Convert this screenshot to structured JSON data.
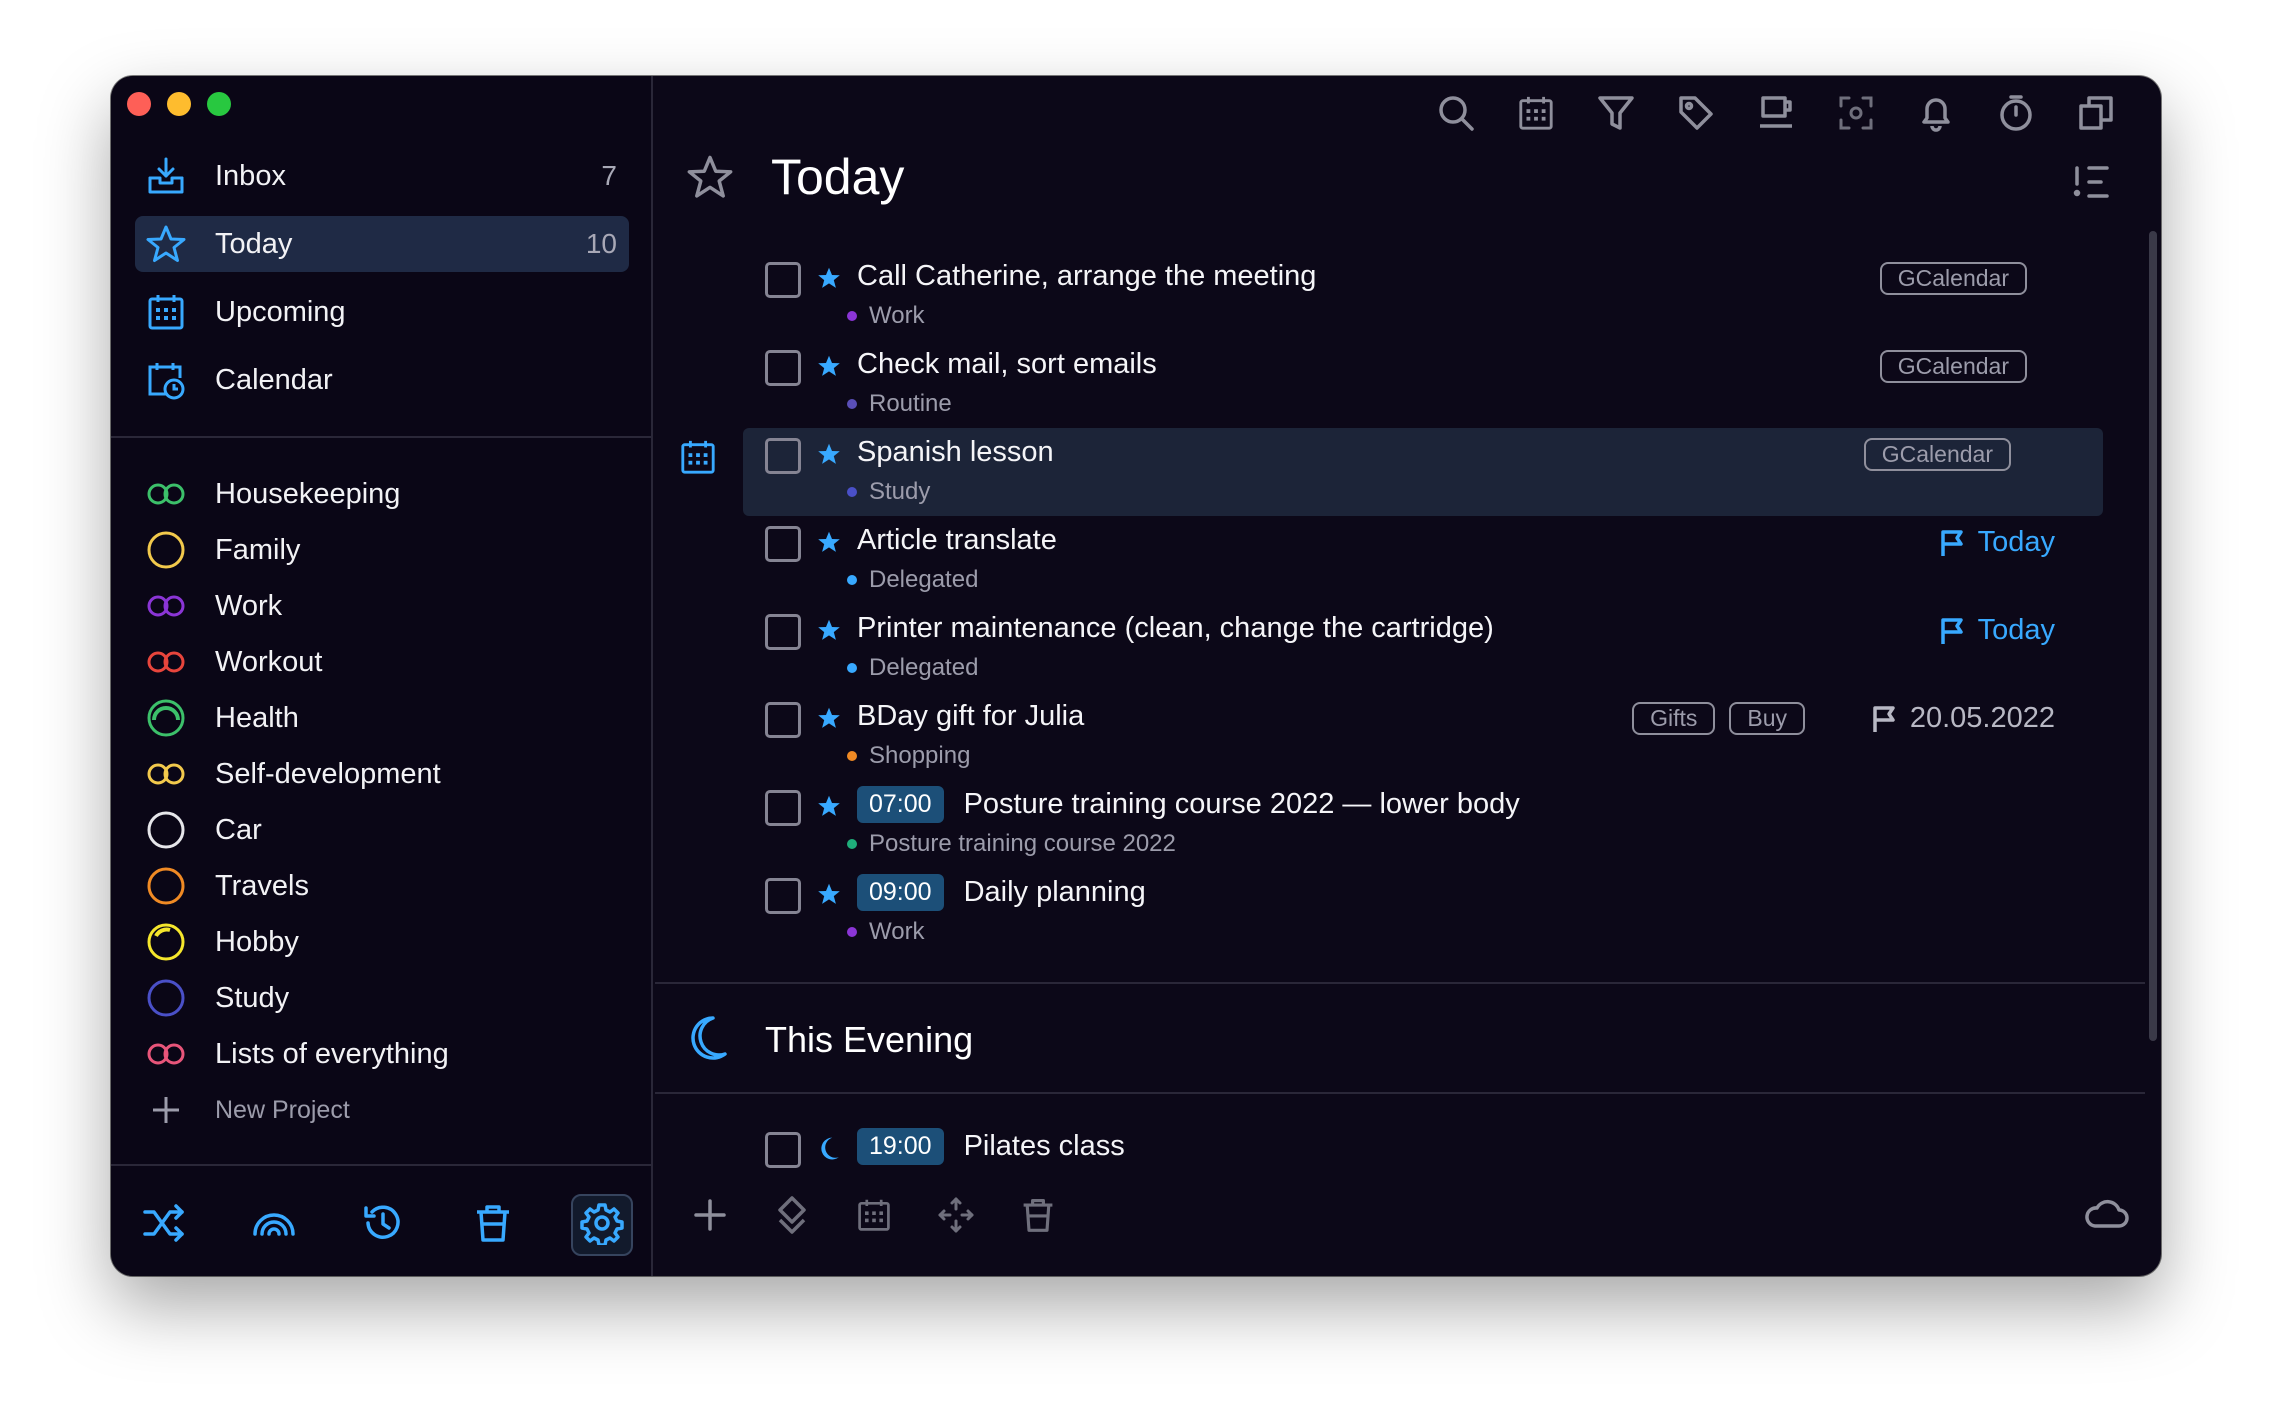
{
  "colors": {
    "accent": "#38a9ff",
    "window_bg": "#0c0818",
    "active_nav_bg": "#1f2a45",
    "highlight_row_bg": "#1c2438",
    "time_badge_bg": "#1c4f78"
  },
  "sidebar": {
    "nav": [
      {
        "label": "Inbox",
        "count": "7",
        "icon": "inbox-icon"
      },
      {
        "label": "Today",
        "count": "10",
        "icon": "star-icon"
      },
      {
        "label": "Upcoming",
        "count": "",
        "icon": "calendar-grid-icon"
      },
      {
        "label": "Calendar",
        "count": "",
        "icon": "calendar-clock-icon"
      }
    ],
    "projects": [
      {
        "label": "Housekeeping",
        "color": "#3cc06a",
        "icon": "infinity-icon"
      },
      {
        "label": "Family",
        "color": "#f2c94c",
        "icon": "circle-icon"
      },
      {
        "label": "Work",
        "color": "#8b35d6",
        "icon": "infinity-icon"
      },
      {
        "label": "Workout",
        "color": "#e8453c",
        "icon": "infinity-icon"
      },
      {
        "label": "Health",
        "color": "#3cc06a",
        "icon": "circle-progress-icon"
      },
      {
        "label": "Self-development",
        "color": "#f2c94c",
        "icon": "infinity-icon"
      },
      {
        "label": "Car",
        "color": "#e6e6ea",
        "icon": "circle-icon"
      },
      {
        "label": "Travels",
        "color": "#f08a24",
        "icon": "circle-icon"
      },
      {
        "label": "Hobby",
        "color": "#f5e62c",
        "icon": "circle-progress-icon"
      },
      {
        "label": "Study",
        "color": "#4a50c8",
        "icon": "circle-icon"
      },
      {
        "label": "Lists of everything",
        "color": "#e8557a",
        "icon": "infinity-icon"
      }
    ],
    "new_project": "New Project",
    "toolbar": [
      "shuffle-icon",
      "rainbow-icon",
      "history-icon",
      "trash-icon",
      "settings-icon"
    ]
  },
  "main": {
    "title": "Today",
    "top_toolbar": [
      "search-icon",
      "calendar-icon",
      "filter-icon",
      "tag-icon",
      "coffee-icon",
      "focus-icon",
      "bell-icon",
      "timer-icon",
      "copy-icon"
    ],
    "tasks": [
      {
        "title": "Call Catherine, arrange the meeting",
        "project": "Work",
        "dot": "#8b35d6",
        "time": "",
        "tags": [
          "GCalendar"
        ],
        "flag": ""
      },
      {
        "title": "Check mail, sort emails",
        "project": "Routine",
        "dot": "#5a4fb8",
        "time": "",
        "tags": [
          "GCalendar"
        ],
        "flag": ""
      },
      {
        "title": "Spanish lesson",
        "project": "Study",
        "dot": "#4a50c8",
        "time": "",
        "tags": [
          "GCalendar"
        ],
        "flag": ""
      },
      {
        "title": "Article translate",
        "project": "Delegated",
        "dot": "#38a9ff",
        "time": "",
        "tags": [],
        "flag": "Today"
      },
      {
        "title": "Printer maintenance (clean, change the cartridge)",
        "project": "Delegated",
        "dot": "#38a9ff",
        "time": "",
        "tags": [],
        "flag": "Today"
      },
      {
        "title": "BDay gift for Julia",
        "project": "Shopping",
        "dot": "#f08a24",
        "time": "",
        "tags": [
          "Gifts",
          "Buy"
        ],
        "flag": "20.05.2022"
      },
      {
        "title": "Posture training course 2022 — lower body",
        "project": "Posture training course 2022",
        "dot": "#1fae7a",
        "time": "07:00",
        "tags": [],
        "flag": ""
      },
      {
        "title": "Daily planning",
        "project": "Work",
        "dot": "#8b35d6",
        "time": "09:00",
        "tags": [],
        "flag": ""
      }
    ],
    "evening": {
      "title": "This Evening",
      "task": {
        "title": "Pilates class",
        "time": "19:00"
      }
    },
    "bottom_toolbar": [
      "add-icon",
      "diamond-icon",
      "calendar-icon",
      "move-icon",
      "trash-icon"
    ]
  }
}
